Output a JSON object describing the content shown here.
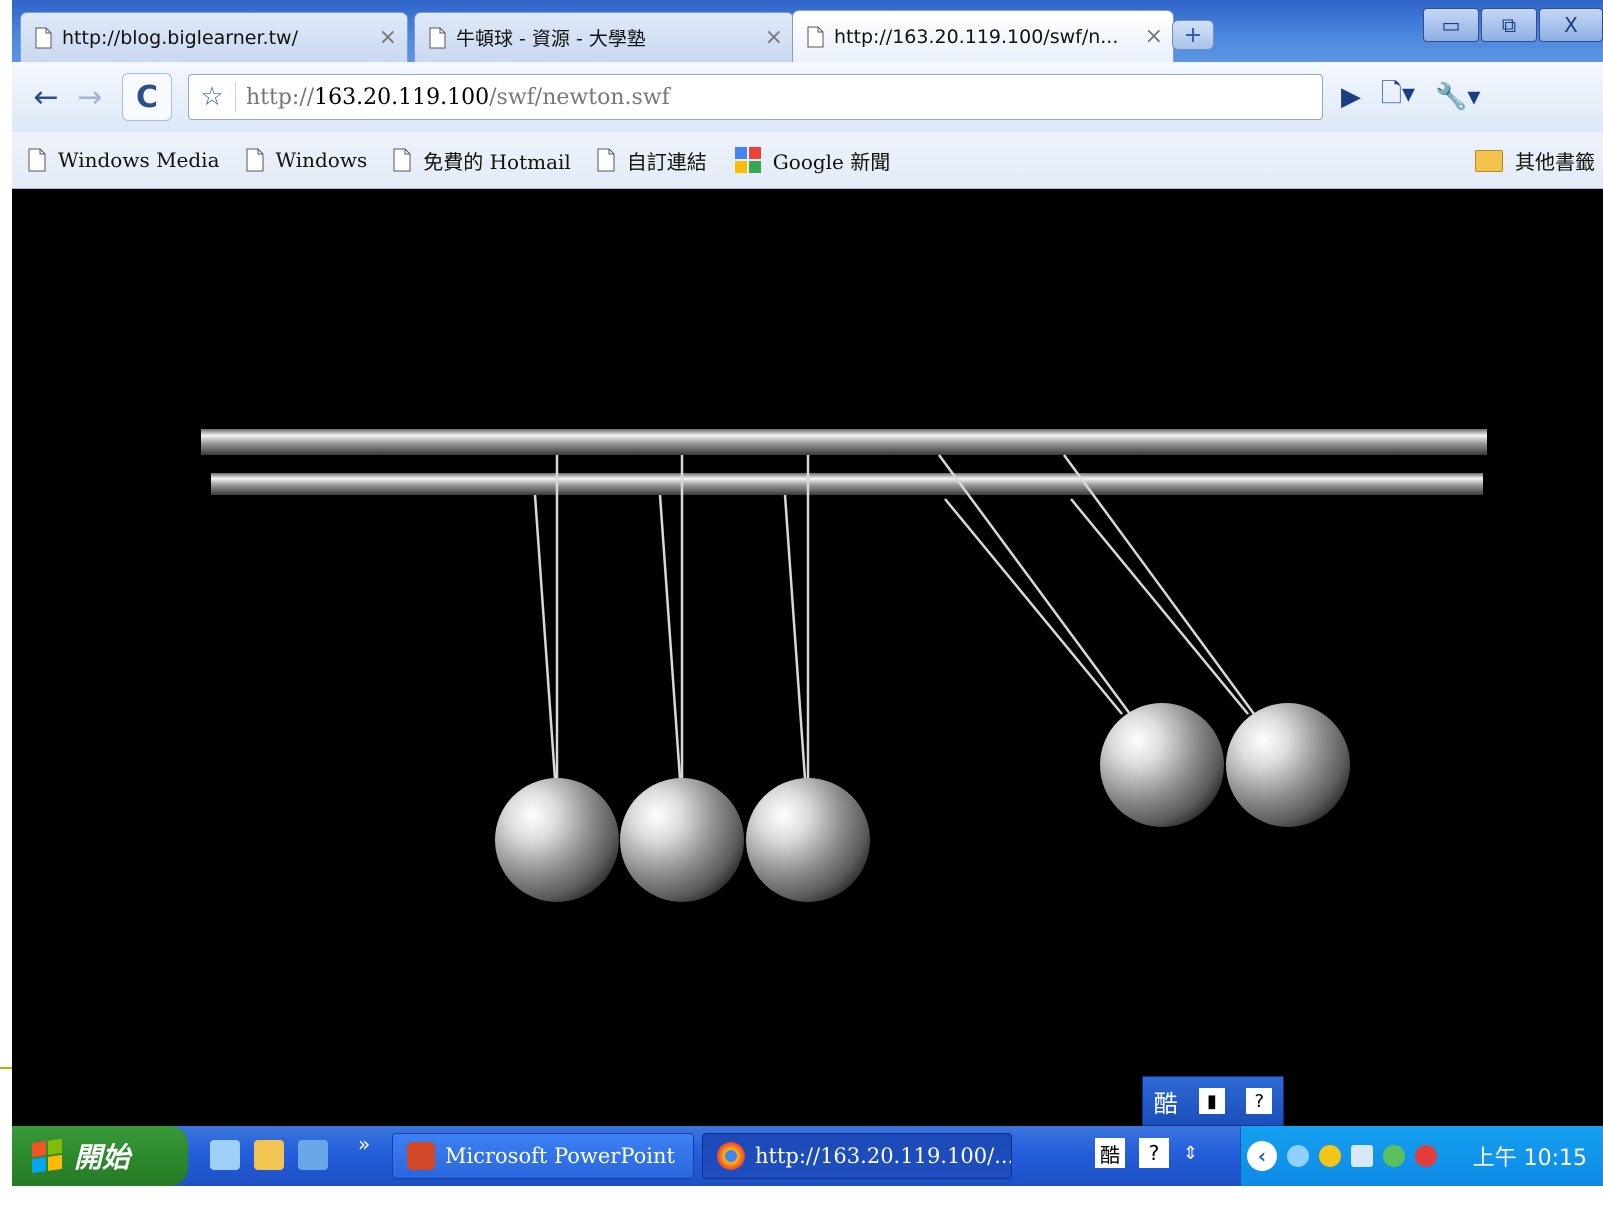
{
  "browser": {
    "tabs": [
      {
        "title": "http://blog.biglearner.tw/",
        "active": false
      },
      {
        "title": "牛頓球 - 資源 - 大學塾",
        "active": false
      },
      {
        "title": "http://163.20.119.100/swf/n...",
        "active": true
      }
    ],
    "tab_close_glyph": "×",
    "new_tab_glyph": "+",
    "window_controls": {
      "minimize": "▭",
      "restore": "⧉",
      "close": "X"
    },
    "nav": {
      "back": "←",
      "forward": "→",
      "reload": "C",
      "star": "☆"
    },
    "url": {
      "scheme": "http://",
      "host": "163.20.119.100",
      "path": "/swf/newton.swf"
    },
    "toolbar_right": {
      "go": "▶",
      "page_menu": "🗋▾",
      "tools_menu": "🔧▾"
    },
    "bookmarks": [
      {
        "label": "Windows Media",
        "icon": "page-icon"
      },
      {
        "label": "Windows",
        "icon": "page-icon"
      },
      {
        "label": "免費的 Hotmail",
        "icon": "page-icon"
      },
      {
        "label": "自訂連結",
        "icon": "page-icon"
      },
      {
        "label": "Google 新聞",
        "icon": "google-news-icon"
      }
    ],
    "other_bookmarks": "其他書籤"
  },
  "content": {
    "description_colors": {
      "background": "#000000",
      "metal": "#c8c8c8"
    },
    "pendulum": {
      "balls_resting": 3,
      "balls_raised": 2,
      "raised_side": "right"
    }
  },
  "language_bar": {
    "ime": "酷",
    "icons": [
      "keyboard-icon",
      "help-icon"
    ]
  },
  "taskbar": {
    "start_label": "開始",
    "quick_launch_more": "»",
    "tasks": [
      {
        "label": "Microsoft PowerPoint",
        "icon": "powerpoint-icon"
      },
      {
        "label": "http://163.20.119.100/...",
        "icon": "chrome-icon"
      }
    ],
    "ime_tray": {
      "ime": "酷",
      "help": "?"
    },
    "tray_expand": "‹",
    "clock": "上午 10:15"
  }
}
